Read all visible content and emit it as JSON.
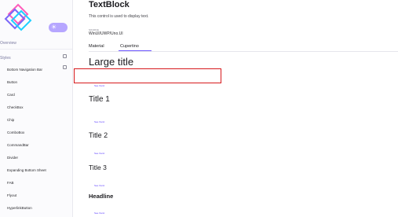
{
  "sidebar": {
    "overview": "Overview",
    "styles": "Styles",
    "items": [
      "Bottom Navigation Bar",
      "Button",
      "Card",
      "CheckBox",
      "Chip",
      "ComboBox",
      "CommandBar",
      "Divider",
      "Expanding Bottom Sheet",
      "FAB",
      "Flyout",
      "HyperlinkButton"
    ],
    "toggle_icon": "sun-icon",
    "accent": "#b6a6ff"
  },
  "header": {
    "title": "TextBlock",
    "description": "This control is used to display text.",
    "source_label": "SOURCE",
    "source_value": "WinUI/UWP/Uno.UI"
  },
  "tabs": [
    {
      "label": "Material",
      "selected": false
    },
    {
      "label": "Cupertino",
      "selected": true
    }
  ],
  "accent_color": "#6e58ff",
  "samples": [
    {
      "label": "Large title",
      "link": "See Xaml"
    },
    {
      "label": "Title 1",
      "link": "See Xaml"
    },
    {
      "label": "Title 2",
      "link": "See Xaml"
    },
    {
      "label": "Title 3",
      "link": "See Xaml"
    },
    {
      "label": "Headline",
      "link": "See Xaml"
    }
  ]
}
